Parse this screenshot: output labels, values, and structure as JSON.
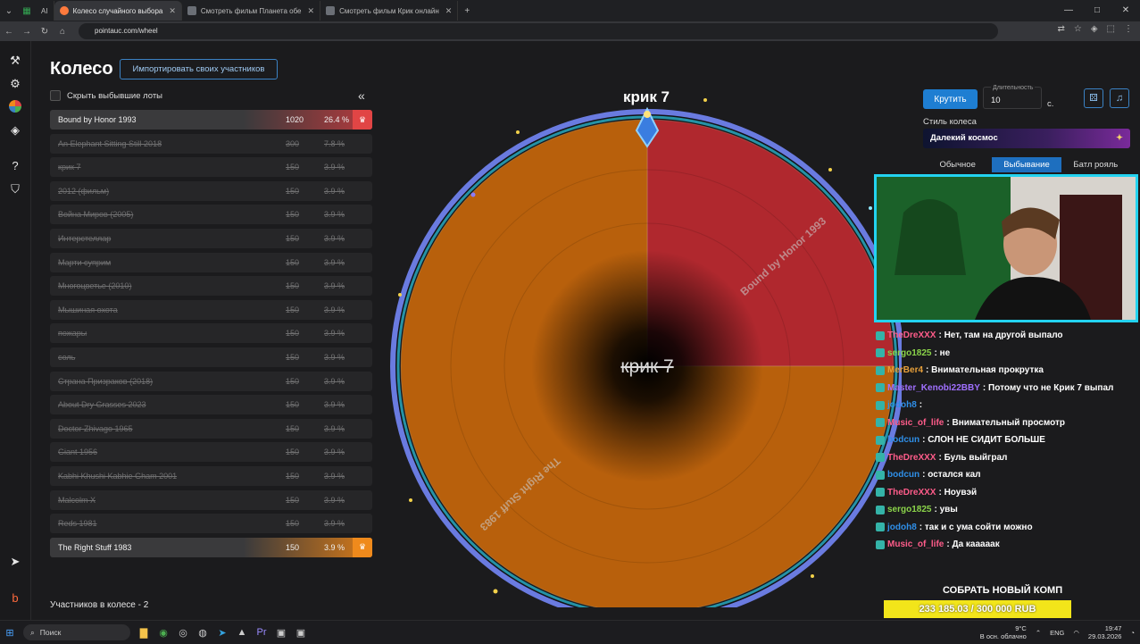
{
  "browser": {
    "tabs": [
      {
        "label": "AI"
      },
      {
        "label": "Колесо случайного выбора"
      },
      {
        "label": "Смотреть фильм Планета обе"
      },
      {
        "label": "Смотреть фильм Крик онлайн"
      }
    ],
    "new_tab": "+",
    "url": "pointauc.com/wheel"
  },
  "page": {
    "title": "Колесо",
    "import_button": "Импортировать своих участников",
    "hide_label": "Скрыть выбывшие лоты",
    "collapse": "«",
    "participants_count": "Участников в колесе - 2"
  },
  "lots": [
    {
      "name": "Bound by Honor 1993",
      "amount": "1020",
      "pct": "26.4 %",
      "state": "active",
      "color": "#e14545"
    },
    {
      "name": "An Elephant Sitting Still 2018",
      "amount": "300",
      "pct": "7.8 %",
      "state": "out"
    },
    {
      "name": "крик 7",
      "amount": "150",
      "pct": "3.9 %",
      "state": "out"
    },
    {
      "name": "2012 (фильм)",
      "amount": "150",
      "pct": "3.9 %",
      "state": "out"
    },
    {
      "name": "Война Миров (2005)",
      "amount": "150",
      "pct": "3.9 %",
      "state": "out"
    },
    {
      "name": "Интерстеллар",
      "amount": "150",
      "pct": "3.9 %",
      "state": "out"
    },
    {
      "name": "Марти суприм",
      "amount": "150",
      "pct": "3.9 %",
      "state": "out"
    },
    {
      "name": "Многоцветье (2010)",
      "amount": "150",
      "pct": "3.9 %",
      "state": "out"
    },
    {
      "name": "Мышиная охота",
      "amount": "150",
      "pct": "3.9 %",
      "state": "out"
    },
    {
      "name": "пожары",
      "amount": "150",
      "pct": "3.9 %",
      "state": "out"
    },
    {
      "name": "соль",
      "amount": "150",
      "pct": "3.9 %",
      "state": "out"
    },
    {
      "name": "Страна Призраков (2018)",
      "amount": "150",
      "pct": "3.9 %",
      "state": "out"
    },
    {
      "name": "About Dry Grasses 2023",
      "amount": "150",
      "pct": "3.9 %",
      "state": "out"
    },
    {
      "name": "Doctor Zhivago 1965",
      "amount": "150",
      "pct": "3.9 %",
      "state": "out"
    },
    {
      "name": "Giant 1956",
      "amount": "150",
      "pct": "3.9 %",
      "state": "out"
    },
    {
      "name": "Kabhi Khushi Kabhie Gham 2001",
      "amount": "150",
      "pct": "3.9 %",
      "state": "out"
    },
    {
      "name": "Malcolm X",
      "amount": "150",
      "pct": "3.9 %",
      "state": "out"
    },
    {
      "name": "Reds 1981",
      "amount": "150",
      "pct": "3.9 %",
      "state": "out"
    },
    {
      "name": "The Right Stuff 1983",
      "amount": "150",
      "pct": "3.9 %",
      "state": "active",
      "color": "#ef8a1c"
    }
  ],
  "wheel": {
    "winner_label": "крик 7",
    "center_label": "крик 7",
    "slices": [
      {
        "name": "Bound by Honor 1993",
        "share": 0.25,
        "color": "#b0282e"
      },
      {
        "name": "The Right Stuff 1983",
        "share": 0.75,
        "color": "#b8600c"
      }
    ]
  },
  "controls": {
    "spin_button": "Крутить",
    "duration_label": "Длительность",
    "duration_value": "10",
    "duration_unit": "с.",
    "style_label": "Стиль колеса",
    "style_value": "Далекий космос",
    "modes": [
      "Обычное",
      "Выбывание",
      "Батл рояль"
    ],
    "selected_mode": "Выбывание"
  },
  "chat": [
    {
      "user": "TheDreXXX",
      "text": ": Нет, там на другой выпало",
      "color": "#ff5c8a"
    },
    {
      "user": "sergo1825",
      "text": ": не",
      "color": "#8bd44a"
    },
    {
      "user": "MerBer4",
      "text": ": Внимательная прокрутка",
      "color": "#e8a03a"
    },
    {
      "user": "Master_Kenobi22BBY",
      "text": ": Потому что не Крик 7 выпал",
      "color": "#a070ff"
    },
    {
      "user": "jodoh8",
      "text": ":",
      "color": "#2f8fe8"
    },
    {
      "user": "Music_of_life",
      "text": ": Внимательный просмотр",
      "color": "#ff5c8a"
    },
    {
      "user": "bodcun",
      "text": ": СЛОН НЕ СИДИТ БОЛЬШЕ",
      "color": "#2f8fe8"
    },
    {
      "user": "TheDreXXX",
      "text": ": Буль выйграл",
      "color": "#ff5c8a"
    },
    {
      "user": "bodcun",
      "text": ": остался кал",
      "color": "#2f8fe8"
    },
    {
      "user": "TheDreXXX",
      "text": ": Ноувэй",
      "color": "#ff5c8a"
    },
    {
      "user": "sergo1825",
      "text": ": увы",
      "color": "#8bd44a"
    },
    {
      "user": "jodoh8",
      "text": ": так и с ума сойти можно",
      "color": "#2f8fe8"
    },
    {
      "user": "Music_of_life",
      "text": ": Да кааааак",
      "color": "#ff5c8a"
    }
  ],
  "collect": {
    "title": "СОБРАТЬ НОВЫЙ КОМП",
    "progress_text": "233 185.03 / 300 000 RUB",
    "progress_fraction": 0.777
  },
  "taskbar": {
    "search": "Поиск",
    "weather_temp": "9°C",
    "weather_text": "В осн. облачно",
    "lang": "ENG",
    "time": "19:47",
    "date": "29.03.2026"
  }
}
